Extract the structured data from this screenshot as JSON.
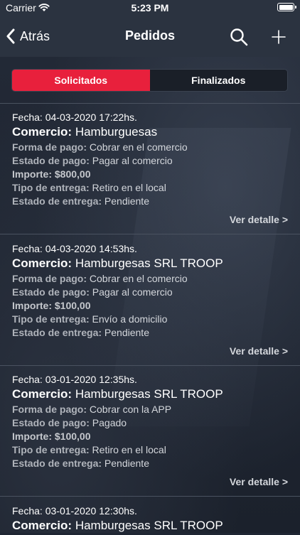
{
  "status": {
    "carrier": "Carrier",
    "time": "5:23 PM"
  },
  "nav": {
    "back_label": "Atrás",
    "title": "Pedidos"
  },
  "tabs": [
    {
      "label": "Solicitados",
      "active": true
    },
    {
      "label": "Finalizados",
      "active": false
    }
  ],
  "labels": {
    "fecha": "Fecha:",
    "comercio": "Comercio:",
    "forma_pago": "Forma de pago:",
    "estado_pago": "Estado de pago:",
    "importe": "Importe:",
    "tipo_entrega": "Tipo de entrega:",
    "estado_entrega": "Estado de entrega:",
    "ver_detalle": "Ver detalle >"
  },
  "orders": [
    {
      "fecha": "04-03-2020 17:22hs.",
      "comercio": "Hamburguesas",
      "forma_pago": "Cobrar en el comercio",
      "estado_pago": "Pagar al comercio",
      "importe": "$800,00",
      "tipo_entrega": "Retiro en el local",
      "estado_entrega": "Pendiente"
    },
    {
      "fecha": "04-03-2020 14:53hs.",
      "comercio": "Hamburgesas SRL TROOP",
      "forma_pago": "Cobrar en el comercio",
      "estado_pago": "Pagar al comercio",
      "importe": "$100,00",
      "tipo_entrega": "Envío a domicilio",
      "estado_entrega": "Pendiente"
    },
    {
      "fecha": "03-01-2020 12:35hs.",
      "comercio": "Hamburgesas SRL TROOP",
      "forma_pago": "Cobrar con la APP",
      "estado_pago": "Pagado",
      "importe": "$100,00",
      "tipo_entrega": "Retiro en el local",
      "estado_entrega": "Pendiente"
    },
    {
      "fecha": "03-01-2020 12:30hs.",
      "comercio": "Hamburgesas SRL TROOP"
    }
  ],
  "colors": {
    "accent": "#e8203c",
    "nav": "#2b3340"
  }
}
